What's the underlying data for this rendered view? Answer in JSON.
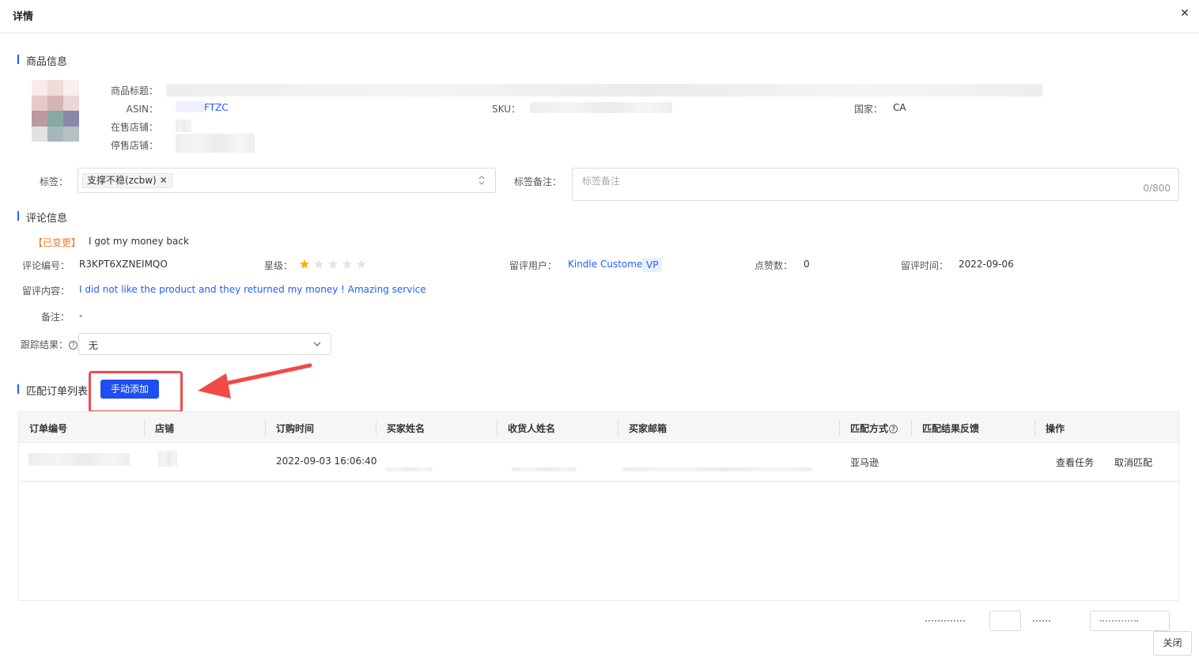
{
  "dialog": {
    "title": "详情"
  },
  "product": {
    "section_title": "商品信息",
    "title_label": "商品标题：",
    "asin_label": "ASIN：",
    "asin_value": "FTZC",
    "sku_label": "SKU：",
    "country_label": "国家：",
    "country_value": "CA",
    "on_sale_label": "在售店铺：",
    "off_sale_label": "停售店铺："
  },
  "tags": {
    "label": "标签：",
    "chip": "支撑不稳(zcbw)",
    "remark_label": "标签备注：",
    "remark_placeholder": "标签备注",
    "remark_count": "0/800"
  },
  "review": {
    "section_title": "评论信息",
    "changed_tag": "【已变更】",
    "headline": "I got my money back",
    "id_label": "评论编号：",
    "id_value": "R3KPT6XZNEIMQO",
    "rating_label": "星级：",
    "rating": 1,
    "rating_max": 5,
    "user_label": "留评用户：",
    "user_value": "Kindle Customer",
    "vp_badge": "VP",
    "likes_label": "点赞数：",
    "likes_value": "0",
    "time_label": "留评时间：",
    "time_value": "2022-09-06",
    "content_label": "留评内容：",
    "content_value": "I did not like the product and they returned my money ! Amazing service",
    "note_label": "备注：",
    "note_value": "-",
    "track_label": "跟踪结果：",
    "track_value": "无"
  },
  "orders": {
    "section_title": "匹配订单列表",
    "add_button": "手动添加",
    "columns": [
      "订单编号",
      "店铺",
      "订购时间",
      "买家姓名",
      "收货人姓名",
      "买家邮箱",
      "匹配方式",
      "匹配结果反馈",
      "操作"
    ],
    "rows": [
      {
        "order_time": "2022-09-03 16:06:40",
        "match_method": "亚马逊",
        "action_view": "查看任务",
        "action_cancel": "取消匹配"
      }
    ]
  },
  "footer": {
    "close_button": "关闭"
  },
  "colors": {
    "primary": "#1f4ff0",
    "link": "#1f5eff",
    "annotation": "#f04a4a",
    "changed": "#f07a1c",
    "star": "#f5b400"
  }
}
